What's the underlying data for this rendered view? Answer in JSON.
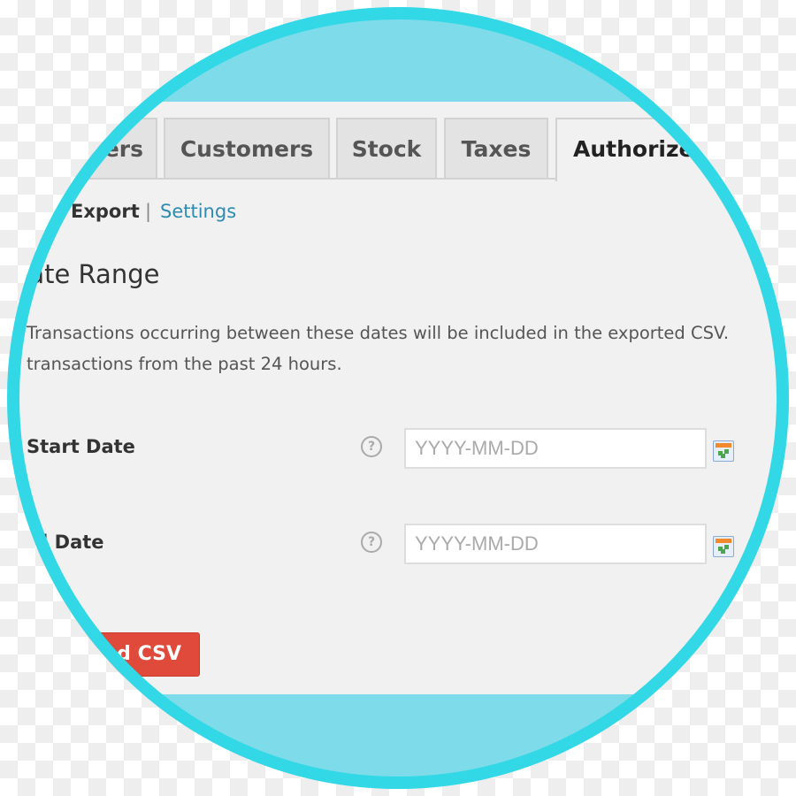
{
  "tabs": [
    {
      "label": "Orders",
      "active": false
    },
    {
      "label": "Customers",
      "active": false
    },
    {
      "label": "Stock",
      "active": false
    },
    {
      "label": "Taxes",
      "active": false
    },
    {
      "label": "Authorize",
      "active": true
    }
  ],
  "subnav": {
    "export": "Export",
    "separator": "|",
    "settings": "Settings"
  },
  "section": {
    "title": "Date Range",
    "description_line1": "Transactions occurring between these dates will be included in the exported CSV.",
    "description_line2": "transactions from the past 24 hours."
  },
  "fields": {
    "start": {
      "label": "Start Date",
      "placeholder": "YYYY-MM-DD",
      "help": "?"
    },
    "end": {
      "label": "End Date",
      "placeholder": "YYYY-MM-DD",
      "help": "?"
    }
  },
  "button": {
    "label": "Download CSV"
  },
  "colors": {
    "ring": "#33d8e6",
    "band": "#7edcea",
    "button": "#e04a3b",
    "link": "#2e8bb0"
  },
  "icons": {
    "help": "question-circle-icon",
    "calendar": "calendar-icon"
  }
}
